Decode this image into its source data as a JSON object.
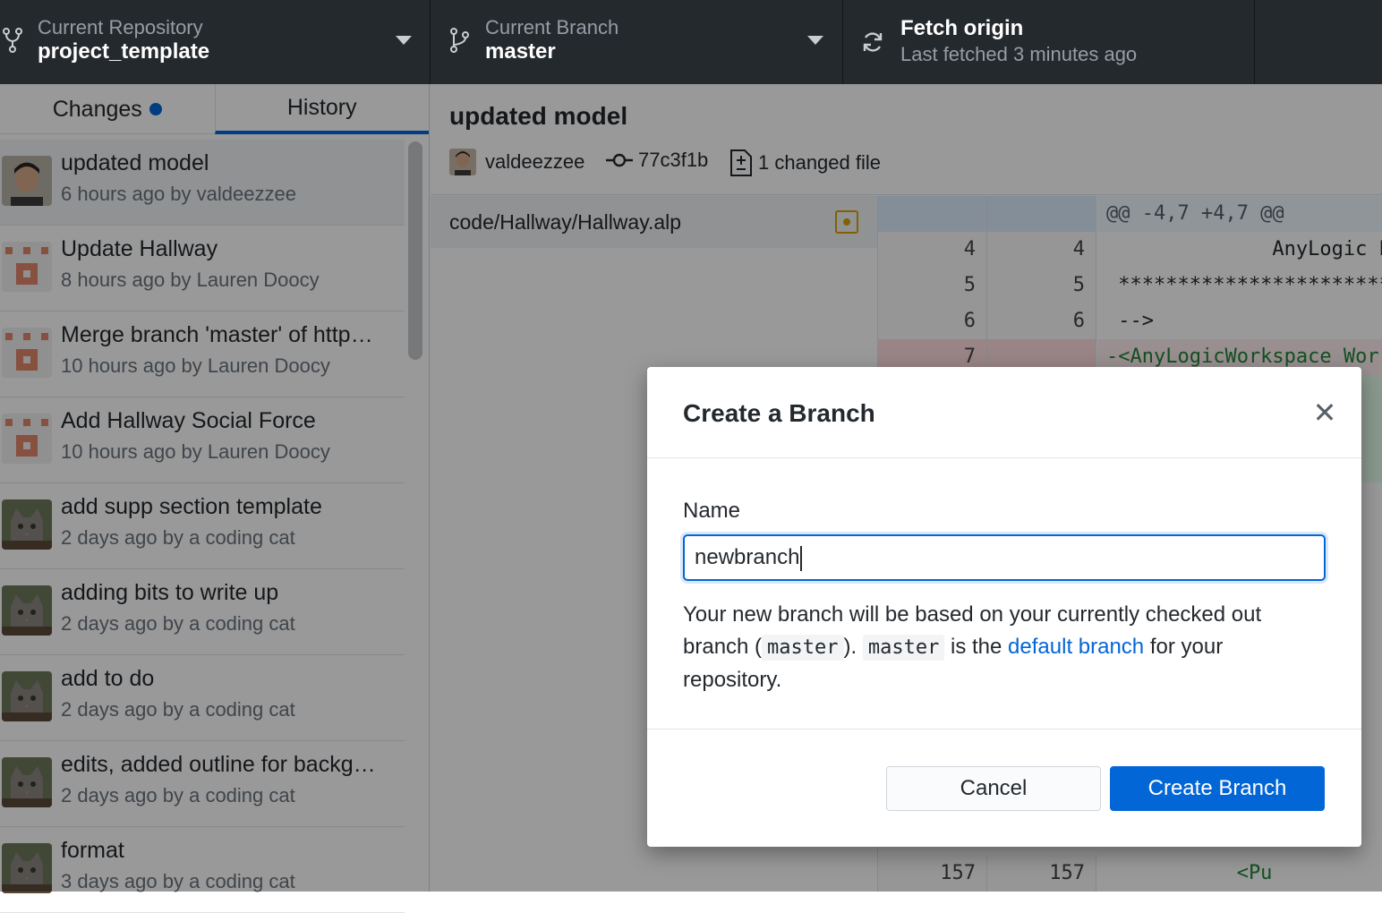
{
  "toolbar": {
    "repository": {
      "label": "Current Repository",
      "value": "project_template"
    },
    "branch": {
      "label": "Current Branch",
      "value": "master"
    },
    "fetch": {
      "title": "Fetch origin",
      "subtitle": "Last fetched 3 minutes ago"
    }
  },
  "sidebar": {
    "tabs": [
      {
        "label": "Changes"
      },
      {
        "label": "History"
      }
    ],
    "commits": [
      {
        "title": "updated model",
        "meta": "6 hours ago by valdeezzee",
        "avatar": "person"
      },
      {
        "title": "Update Hallway",
        "meta": "8 hours ago by Lauren Doocy",
        "avatar": "identicon"
      },
      {
        "title": "Merge branch 'master' of http…",
        "meta": "10 hours ago by Lauren Doocy",
        "avatar": "identicon"
      },
      {
        "title": "Add Hallway Social Force",
        "meta": "10 hours ago by Lauren Doocy",
        "avatar": "identicon"
      },
      {
        "title": "add supp section template",
        "meta": "2 days ago by a coding cat",
        "avatar": "cat"
      },
      {
        "title": "adding bits to write up",
        "meta": "2 days ago by a coding cat",
        "avatar": "cat"
      },
      {
        "title": "add to do",
        "meta": "2 days ago by a coding cat",
        "avatar": "cat"
      },
      {
        "title": "edits, added outline for backg…",
        "meta": "2 days ago by a coding cat",
        "avatar": "cat"
      },
      {
        "title": "format",
        "meta": "3 days ago by a coding cat",
        "avatar": "cat"
      }
    ]
  },
  "commit": {
    "title": "updated model",
    "author": "valdeezzee",
    "sha": "77c3f1b",
    "changed_files": "1 changed file"
  },
  "files": [
    {
      "path": "code/Hallway/Hallway.alp",
      "status": "modified"
    }
  ],
  "diff": {
    "hunk": "@@ -4,7 +4,7 @@",
    "rows": [
      {
        "a": "4",
        "b": "4",
        "text": "              AnyLogic P"
      },
      {
        "a": "5",
        "b": "5",
        "text": " *************************"
      },
      {
        "a": "6",
        "b": "6",
        "text": " -->"
      },
      {
        "a": "7",
        "b": "",
        "text": "-<AnyLogicWorkspace Wor"
      }
    ],
    "bottom_row": {
      "a": "157",
      "b": "157",
      "text": "           <Pu"
    }
  },
  "dialog": {
    "title": "Create a Branch",
    "name_label": "Name",
    "name_value": "newbranch",
    "desc_1": "Your new branch will be based on your currently checked out branch (",
    "ref_1": "master",
    "desc_2": "). ",
    "ref_2": "master",
    "desc_3": " is the ",
    "link": "default branch",
    "desc_4": " for your repository.",
    "cancel_label": "Cancel",
    "create_label": "Create Branch"
  },
  "colors": {
    "accent": "#0366d6",
    "toolbar_bg": "#24292e",
    "modified": "#d9a400"
  }
}
